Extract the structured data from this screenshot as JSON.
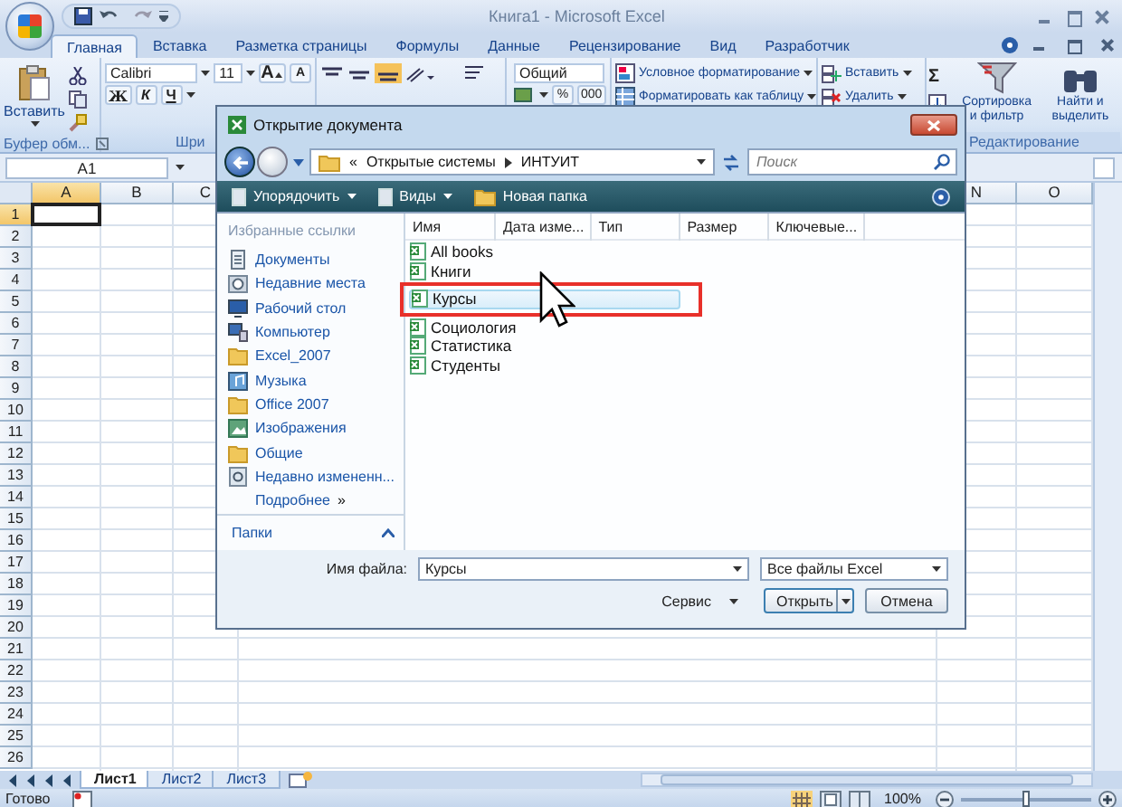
{
  "window": {
    "title": "Книга1 - Microsoft Excel"
  },
  "ribbon_tabs": [
    {
      "label": "Главная",
      "selected": true
    },
    {
      "label": "Вставка",
      "selected": false
    },
    {
      "label": "Разметка страницы",
      "selected": false
    },
    {
      "label": "Формулы",
      "selected": false
    },
    {
      "label": "Данные",
      "selected": false
    },
    {
      "label": "Рецензирование",
      "selected": false
    },
    {
      "label": "Вид",
      "selected": false
    },
    {
      "label": "Разработчик",
      "selected": false
    }
  ],
  "ribbon": {
    "clipboard": {
      "paste": "Вставить",
      "label": "Буфер обм..."
    },
    "font": {
      "name": "Calibri",
      "size": "11",
      "grow": "A",
      "shrink": "A",
      "bold": "Ж",
      "italic": "К",
      "underline": "Ч",
      "label": "Шри"
    },
    "number": {
      "format": "Общий",
      "percent": "%",
      "thousands": "000"
    },
    "styles": [
      "Условное форматирование",
      "Форматировать как таблицу"
    ],
    "cells": [
      "Вставить",
      "Удалить"
    ],
    "editing": {
      "sum": "Σ",
      "sort": "Сортировка и фильтр",
      "find": "Найти и выделить",
      "label": "Редактирование"
    }
  },
  "formula_bar": {
    "name_box": "A1"
  },
  "grid": {
    "columns": [
      {
        "label": "A",
        "selected": true
      },
      {
        "label": "B",
        "selected": false
      },
      {
        "label": "C",
        "selected": false
      },
      {
        "label": "N",
        "selected": false
      },
      {
        "label": "O",
        "selected": false
      }
    ],
    "rows": [
      "1",
      "2",
      "3",
      "4",
      "5",
      "6",
      "7",
      "8",
      "9",
      "10",
      "11",
      "12",
      "13",
      "14",
      "15",
      "16",
      "17",
      "18",
      "19",
      "20",
      "21",
      "22",
      "23",
      "24",
      "25",
      "26"
    ]
  },
  "sheet_tabs": [
    {
      "label": "Лист1",
      "selected": true
    },
    {
      "label": "Лист2",
      "selected": false
    },
    {
      "label": "Лист3",
      "selected": false
    }
  ],
  "status_bar": {
    "status": "Готово",
    "zoom": "100%",
    "zoom_slider": {
      "level": 0.5
    }
  },
  "dialog": {
    "title": "Открытие документа",
    "overflow": "«",
    "breadcrumb": [
      "Открытые системы",
      "ИНТУИТ"
    ],
    "search": {
      "placeholder": "Поиск"
    },
    "toolbar": [
      {
        "label": "Упорядочить",
        "kind": "menu"
      },
      {
        "label": "Виды",
        "kind": "menu"
      },
      {
        "label": "Новая папка",
        "kind": "folder"
      }
    ],
    "favorites_title": "Избранные ссылки",
    "links": [
      {
        "label": "Документы",
        "kind": "documents"
      },
      {
        "label": "Недавние места",
        "kind": "recent"
      },
      {
        "label": "Рабочий стол",
        "kind": "desktop"
      },
      {
        "label": "Компьютер",
        "kind": "computer"
      },
      {
        "label": "Excel_2007",
        "kind": "folder"
      },
      {
        "label": "Музыка",
        "kind": "music"
      },
      {
        "label": "Office 2007",
        "kind": "folder"
      },
      {
        "label": "Изображения",
        "kind": "pictures"
      },
      {
        "label": "Общие",
        "kind": "folder"
      },
      {
        "label": "Недавно измененн...",
        "kind": "search"
      }
    ],
    "more": "Подробнее",
    "more_mark": "»",
    "folders": "Папки",
    "columns": [
      "Имя",
      "Дата изме...",
      "Тип",
      "Размер",
      "Ключевые..."
    ],
    "files": [
      {
        "name": "All books",
        "selected": false
      },
      {
        "name": "Книги",
        "selected": false
      },
      {
        "name": "Курсы",
        "selected": true
      },
      {
        "name": "Социология",
        "selected": false
      },
      {
        "name": "Статистика",
        "selected": false
      },
      {
        "name": "Студенты",
        "selected": false
      }
    ],
    "file_name": {
      "label": "Имя файла:",
      "value": "Курсы"
    },
    "file_type": "Все файлы Excel",
    "tools": "Сервис",
    "open": "Открыть",
    "cancel": "Отмена"
  }
}
